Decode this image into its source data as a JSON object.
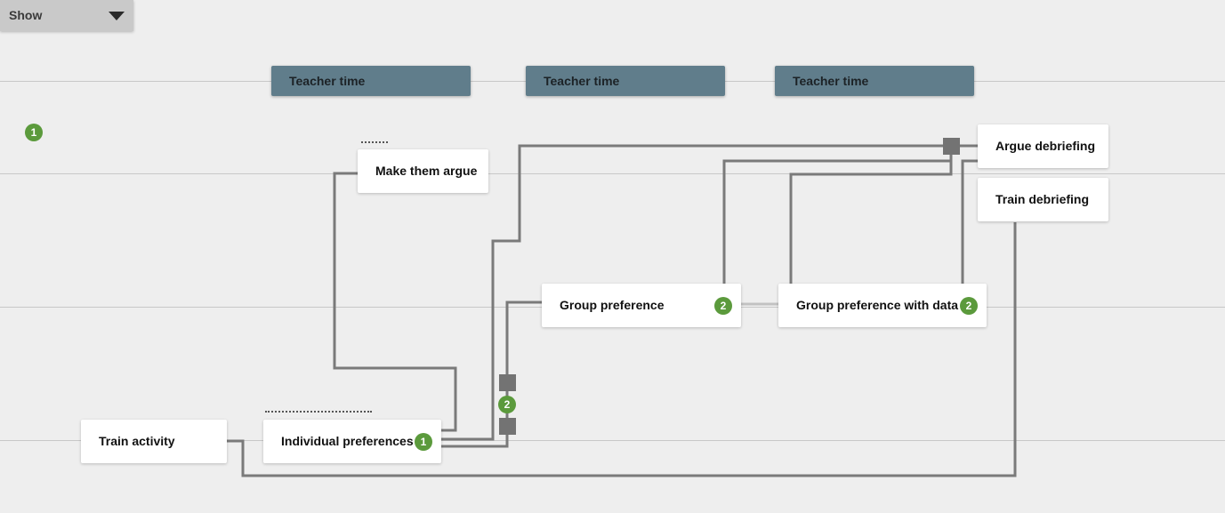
{
  "toolbar": {
    "show_label": "Show",
    "caret_icon": "caret-down-icon"
  },
  "planes": {
    "badge": "1"
  },
  "teacher_bars": [
    {
      "label": "Teacher time"
    },
    {
      "label": "Teacher time"
    },
    {
      "label": "Teacher time"
    }
  ],
  "activities": {
    "train_activity": {
      "title": "Train activity"
    },
    "individual_preferences": {
      "title": "Individual preferences",
      "badge": "1"
    },
    "make_them_argue": {
      "title": "Make them argue"
    },
    "group_preference": {
      "title": "Group preference",
      "badge": "2"
    },
    "group_preference_with_data": {
      "title": "Group preference with data",
      "badge": "2"
    },
    "argue_debriefing": {
      "title": "Argue debriefing"
    },
    "train_debriefing": {
      "title": "Train debriefing"
    }
  },
  "operator": {
    "badge": "2"
  },
  "colors": {
    "background": "#eeeeee",
    "teacher_bar": "#607d8b",
    "badge_green": "#5b9a3c",
    "connector": "#7a7a7a",
    "gate": "#737373"
  }
}
